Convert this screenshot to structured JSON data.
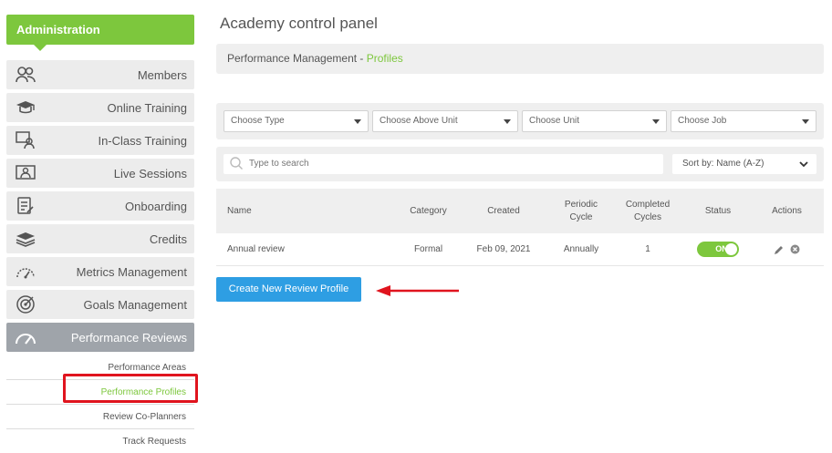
{
  "sidebar": {
    "header": "Administration",
    "items": [
      {
        "label": "Members",
        "icon": "members-icon"
      },
      {
        "label": "Online Training",
        "icon": "graduation-cap-icon"
      },
      {
        "label": "In-Class Training",
        "icon": "classroom-icon"
      },
      {
        "label": "Live Sessions",
        "icon": "presentation-icon"
      },
      {
        "label": "Onboarding",
        "icon": "checklist-icon"
      },
      {
        "label": "Credits",
        "icon": "layers-icon"
      },
      {
        "label": "Metrics Management",
        "icon": "gauge-icon"
      },
      {
        "label": "Goals Management",
        "icon": "target-icon"
      },
      {
        "label": "Performance Reviews",
        "icon": "speedometer-icon"
      }
    ],
    "subitems": [
      {
        "label": "Performance Areas"
      },
      {
        "label": "Performance Profiles"
      },
      {
        "label": "Review Co-Planners"
      },
      {
        "label": "Track Requests"
      }
    ]
  },
  "page": {
    "title": "Academy control panel",
    "breadcrumb_prefix": "Performance Management - ",
    "breadcrumb_current": "Profiles"
  },
  "filters": {
    "type": "Choose Type",
    "above_unit": "Choose Above Unit",
    "unit": "Choose Unit",
    "job": "Choose Job"
  },
  "search": {
    "placeholder": "Type to search",
    "sort": "Sort by: Name (A-Z)"
  },
  "table": {
    "headers": {
      "name": "Name",
      "category": "Category",
      "created": "Created",
      "periodic": "Periodic Cycle",
      "completed": "Completed Cycles",
      "status": "Status",
      "actions": "Actions"
    },
    "rows": [
      {
        "name": "Annual review",
        "category": "Formal",
        "created": "Feb 09, 2021",
        "periodic": "Annually",
        "completed": "1",
        "status": "ON"
      }
    ]
  },
  "actions": {
    "create": "Create New Review Profile"
  },
  "colors": {
    "accent_green": "#7dc73d",
    "button_blue": "#2e9ee3",
    "annotation_red": "#e0141e"
  }
}
